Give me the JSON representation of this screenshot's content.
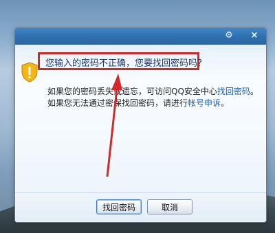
{
  "dialog": {
    "headline": "您输入的密码不正确，您要找回密码吗？",
    "line1_prefix": "如果您的密码丢失或遗忘，可访问QQ安全中心",
    "line1_link": "找回密码",
    "line1_suffix": "。",
    "line2_prefix": "如果您无法通过密保找回密码，请进行",
    "line2_link": "帐号申诉",
    "line2_suffix": "。"
  },
  "titlebar": {
    "gear_icon": "gear-icon",
    "close_label": "×"
  },
  "buttons": {
    "primary_label": "找回密码",
    "cancel_label": "取消"
  },
  "colors": {
    "headline_text": "#1e3964",
    "link": "#1a5fb4",
    "highlight_border": "#cc2a2a",
    "titlebar": "#2e6fae"
  }
}
